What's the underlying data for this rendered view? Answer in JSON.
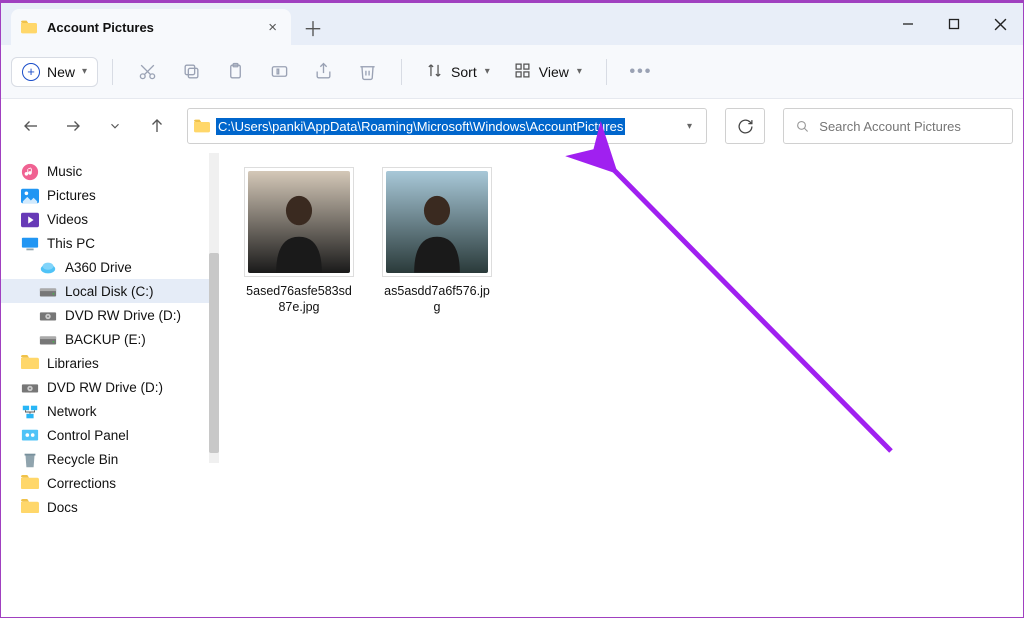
{
  "window": {
    "title": "Account Pictures"
  },
  "toolbar": {
    "new_label": "New",
    "sort_label": "Sort",
    "view_label": "View"
  },
  "address": {
    "path": "C:\\Users\\panki\\AppData\\Roaming\\Microsoft\\Windows\\AccountPictures"
  },
  "search": {
    "placeholder": "Search Account Pictures"
  },
  "sidebar": {
    "items": [
      {
        "label": "Music",
        "icon": "music",
        "nested": false
      },
      {
        "label": "Pictures",
        "icon": "pictures",
        "nested": false
      },
      {
        "label": "Videos",
        "icon": "videos",
        "nested": false
      },
      {
        "label": "This PC",
        "icon": "pc",
        "nested": false
      },
      {
        "label": "A360 Drive",
        "icon": "cloud-drive",
        "nested": true
      },
      {
        "label": "Local Disk (C:)",
        "icon": "disk",
        "nested": true,
        "selected": true
      },
      {
        "label": "DVD RW Drive (D:)",
        "icon": "dvd",
        "nested": true
      },
      {
        "label": "BACKUP (E:)",
        "icon": "disk",
        "nested": true
      },
      {
        "label": "Libraries",
        "icon": "folder",
        "nested": false
      },
      {
        "label": "DVD RW Drive (D:)",
        "icon": "dvd",
        "nested": false
      },
      {
        "label": "Network",
        "icon": "network",
        "nested": false
      },
      {
        "label": "Control Panel",
        "icon": "control-panel",
        "nested": false
      },
      {
        "label": "Recycle Bin",
        "icon": "recycle-bin",
        "nested": false
      },
      {
        "label": "Corrections",
        "icon": "folder",
        "nested": false
      },
      {
        "label": "Docs",
        "icon": "folder",
        "nested": false
      }
    ]
  },
  "files": [
    {
      "name": "5ased76asfe583sd87e.jpg"
    },
    {
      "name": "as5asdd7a6f576.jpg"
    }
  ]
}
